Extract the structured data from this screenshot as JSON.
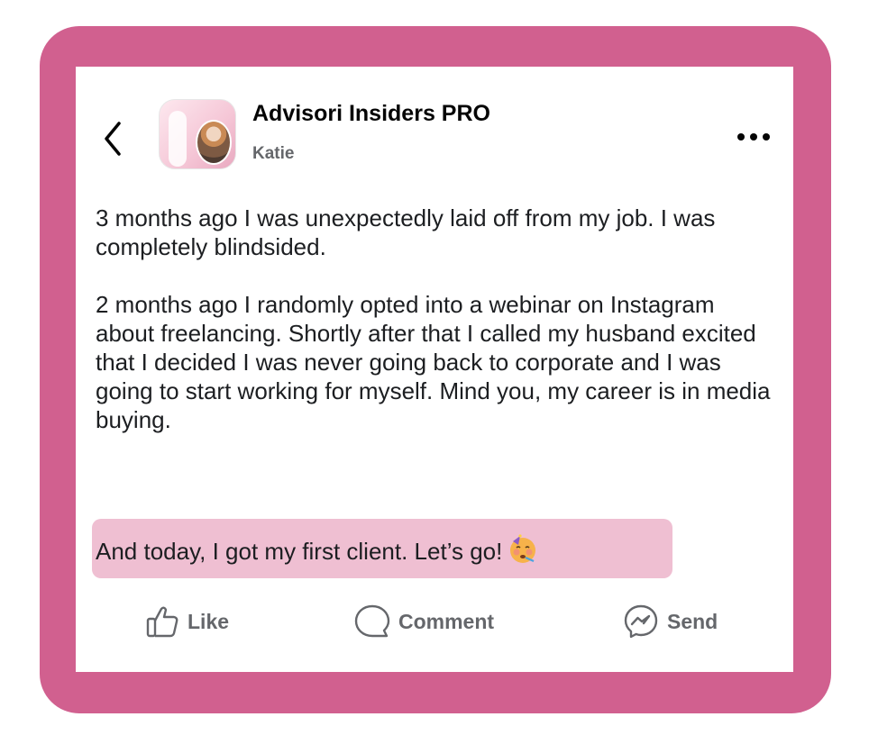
{
  "header": {
    "group_name": "Advisori Insiders PRO",
    "author_name": "Katie"
  },
  "post": {
    "paragraphs": [
      "3 months ago I was unexpectedly laid off from my job. I was completely blindsided.",
      "2 months ago I randomly opted into a webinar on Instagram about freelancing. Shortly after that I called my husband excited that I decided I was never going back to corporate and I was going to start working for myself. Mind you, my career is in media buying."
    ],
    "highlight": "And today, I got my first client. Let’s go!"
  },
  "actions": {
    "like": "Like",
    "comment": "Comment",
    "send": "Send"
  },
  "icons": {
    "back": "chevron-left-icon",
    "more": "more-dots-icon",
    "like": "thumbs-up-icon",
    "comment": "speech-bubble-icon",
    "send": "messenger-icon",
    "celebrate": "partying-face-emoji"
  },
  "colors": {
    "frame": "#d1608f",
    "highlight": "#efbfd2",
    "secondary_text": "#65676b"
  }
}
